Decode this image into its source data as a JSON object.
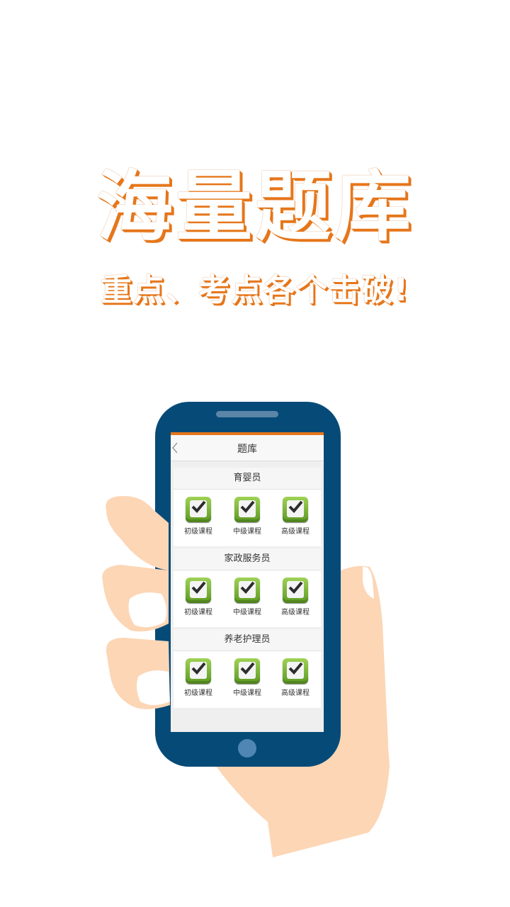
{
  "promo": {
    "title": "海量题库",
    "subtitle": "重点、考点各个击破!"
  },
  "app": {
    "header_title": "题库",
    "sections": [
      {
        "name": "育婴员",
        "courses": [
          "初级课程",
          "中级课程",
          "高级课程"
        ]
      },
      {
        "name": "家政服务员",
        "courses": [
          "初级课程",
          "中级课程",
          "高级课程"
        ]
      },
      {
        "name": "养老护理员",
        "courses": [
          "初级课程",
          "中级课程",
          "高级课程"
        ]
      }
    ]
  },
  "colors": {
    "accent_orange": "#e6761a",
    "phone_body": "#064b78",
    "skin": "#fcd6b5",
    "icon_green": "#6fae2e"
  },
  "icons": {
    "back": "chevron-left-icon",
    "course": "green-check-icon"
  }
}
